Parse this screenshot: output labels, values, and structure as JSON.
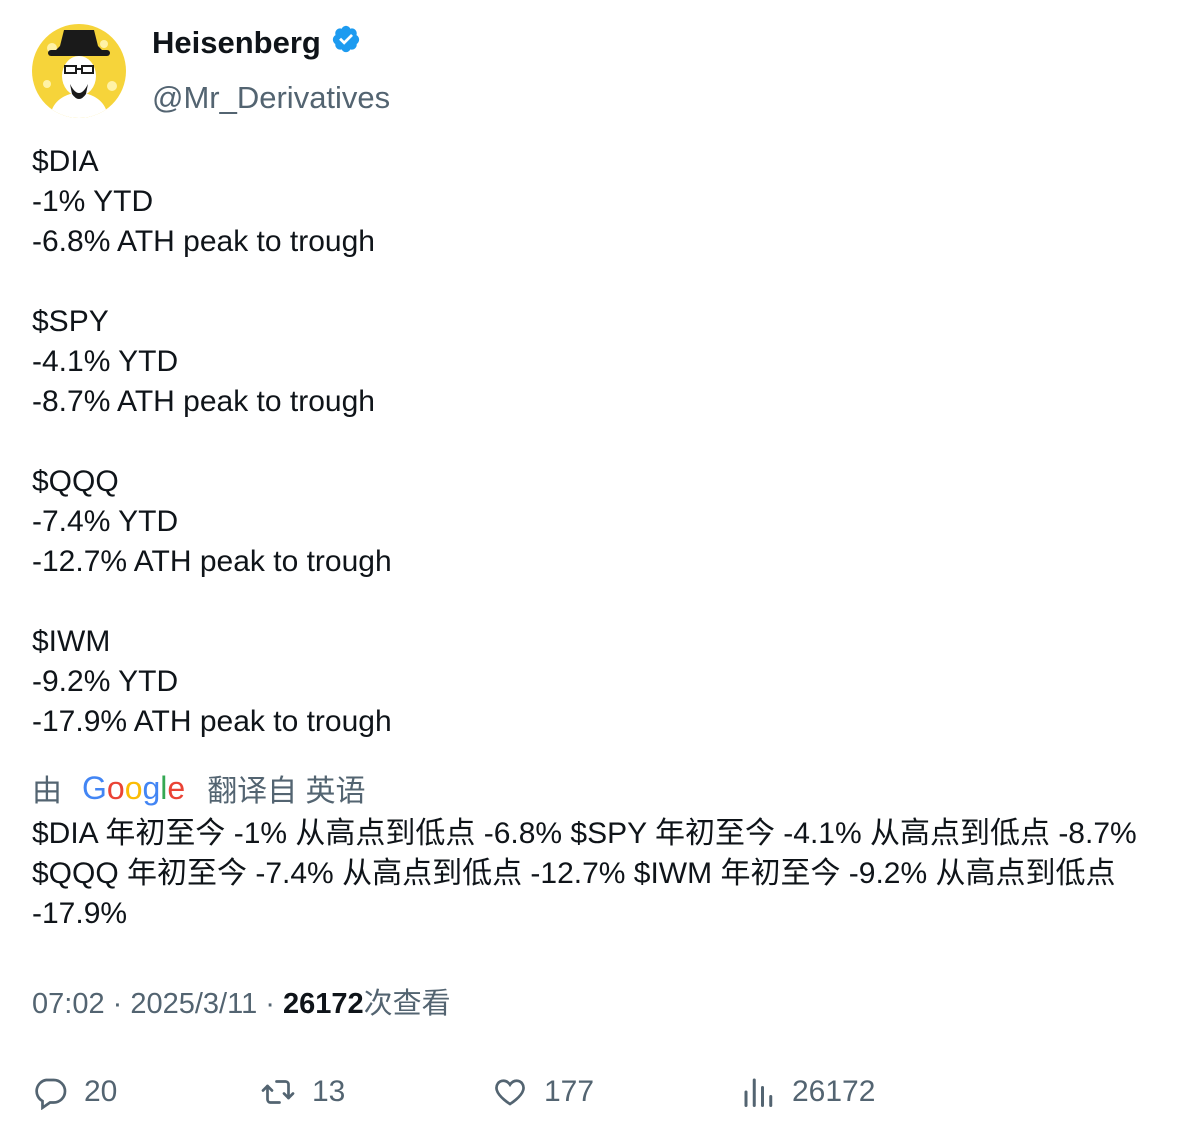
{
  "user": {
    "display_name": "Heisenberg",
    "handle": "@Mr_Derivatives",
    "verified_color": "#1d9bf0"
  },
  "tweet": {
    "lines": [
      "$DIA",
      "-1% YTD",
      "-6.8% ATH peak to trough",
      "",
      "$SPY",
      "-4.1% YTD",
      "-8.7% ATH peak to trough",
      "",
      "$QQQ",
      "-7.4% YTD",
      "-12.7% ATH peak to trough",
      "",
      "$IWM",
      "-9.2% YTD",
      "-17.9% ATH peak to trough"
    ]
  },
  "translation": {
    "prefix": "由",
    "provider": "Google",
    "suffix": "翻译自 英语",
    "text": "$DIA 年初至今 -1% 从高点到低点 -6.8% $SPY 年初至今 -4.1% 从高点到低点 -8.7% $QQQ 年初至今 -7.4% 从高点到低点 -12.7% $IWM 年初至今 -9.2% 从高点到低点 -17.9%"
  },
  "meta": {
    "time": "07:02",
    "sep1": " · ",
    "date": "2025/3/11",
    "sep2": " · ",
    "views": "26172",
    "views_label": "次查看"
  },
  "actions": {
    "replies": "20",
    "retweets": "13",
    "likes": "177",
    "views": "26172"
  },
  "colors": {
    "text": "#0f1419",
    "secondary": "#536471",
    "avatar_bg": "#f5d33a"
  }
}
